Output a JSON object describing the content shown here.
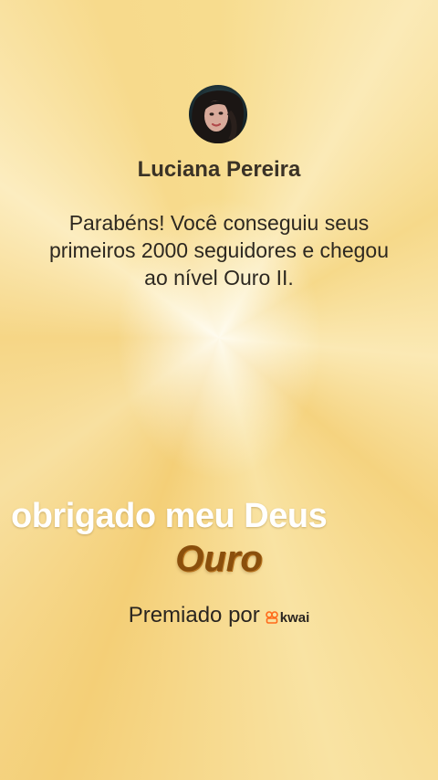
{
  "profile": {
    "avatar_icon": "user-avatar-photo",
    "name": "Luciana Pereira"
  },
  "message": "Parabéns! Você conseguiu seus primeiros 2000 seguidores e chegou ao nível Ouro II.",
  "caption": "obrigado meu Deus",
  "level_title": "Ouro",
  "award": {
    "label": "Premiado por",
    "brand_icon": "kwai-logo-icon",
    "brand_name": "kwai",
    "brand_color": "#ff6a1a"
  }
}
